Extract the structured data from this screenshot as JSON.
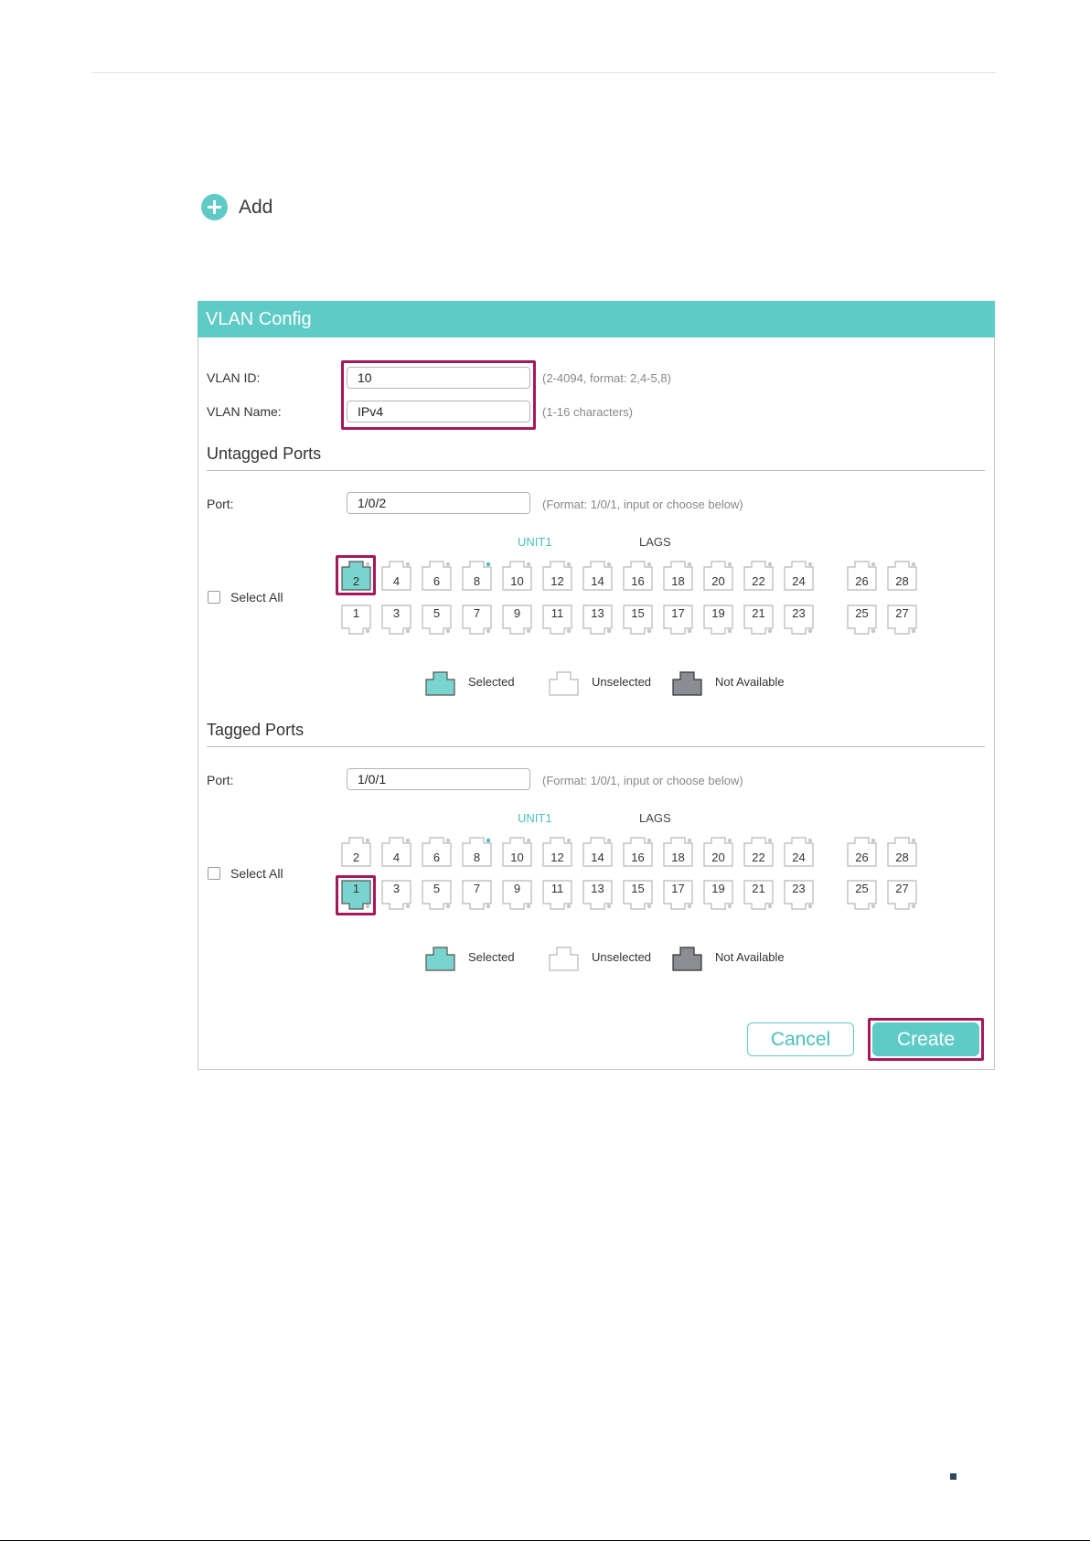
{
  "add": {
    "label": "Add"
  },
  "panel": {
    "title": "VLAN Config",
    "vlan_id": {
      "label": "VLAN ID:",
      "value": "10",
      "hint": "(2-4094, format: 2,4-5,8)"
    },
    "vlan_name": {
      "label": "VLAN Name:",
      "value": "IPv4",
      "hint": "(1-16 characters)"
    }
  },
  "untagged": {
    "title": "Untagged Ports",
    "port_label": "Port:",
    "port_value": "1/0/2",
    "port_hint": "(Format: 1/0/1, input or choose below)",
    "unit_label": "UNIT1",
    "lags_label": "LAGS",
    "select_all": "Select All",
    "selected_ports": [
      "2"
    ]
  },
  "tagged": {
    "title": "Tagged Ports",
    "port_label": "Port:",
    "port_value": "1/0/1",
    "port_hint": "(Format: 1/0/1, input or choose below)",
    "unit_label": "UNIT1",
    "lags_label": "LAGS",
    "select_all": "Select All",
    "selected_ports": [
      "1"
    ]
  },
  "ports": {
    "top_row": [
      "2",
      "4",
      "6",
      "8",
      "10",
      "12",
      "14",
      "16",
      "18",
      "20",
      "22",
      "24",
      "26",
      "28"
    ],
    "bottom_row": [
      "1",
      "3",
      "5",
      "7",
      "9",
      "11",
      "13",
      "15",
      "17",
      "19",
      "21",
      "23",
      "25",
      "27"
    ],
    "linked_port": "8"
  },
  "legend": {
    "selected": "Selected",
    "unselected": "Unselected",
    "not_available": "Not Available"
  },
  "buttons": {
    "cancel": "Cancel",
    "create": "Create"
  },
  "colors": {
    "accent": "#5ecbc6",
    "highlight": "#a6185e",
    "not_available": "#8a8d93"
  }
}
